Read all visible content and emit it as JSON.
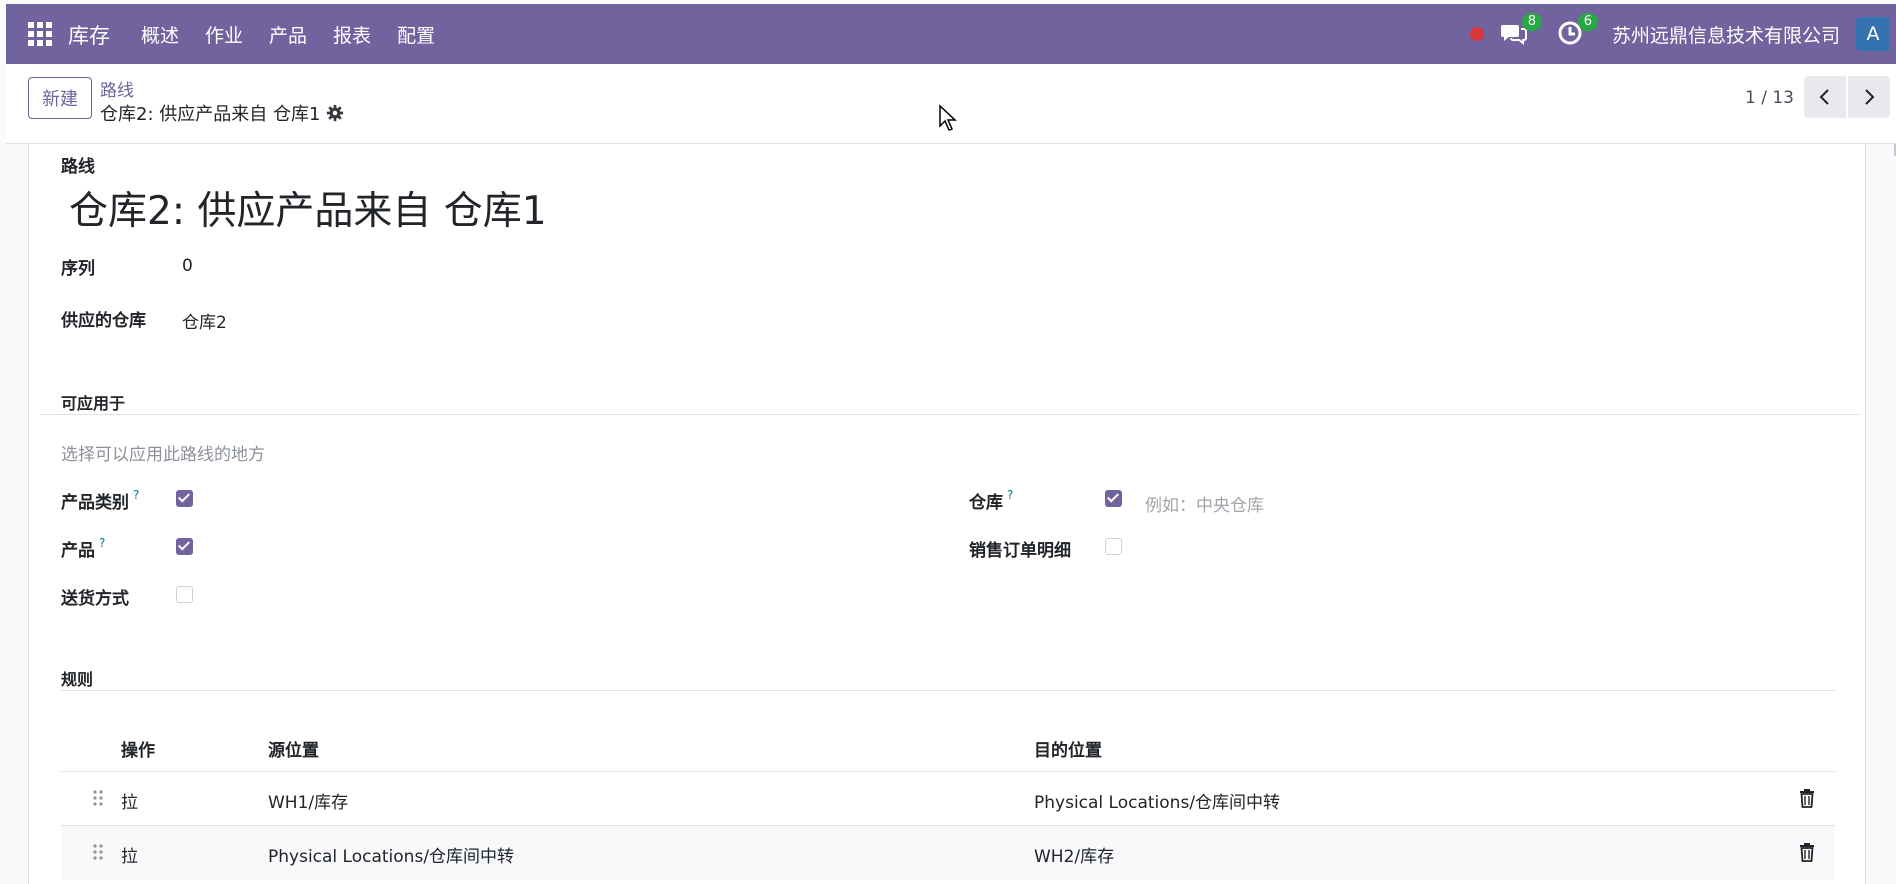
{
  "navbar": {
    "brand": "库存",
    "menu": [
      "概述",
      "作业",
      "产品",
      "报表",
      "配置"
    ],
    "messages_count": "8",
    "activities_count": "6",
    "company": "苏州远鼎信息技术有限公司",
    "avatar": "A",
    "bg_color": "#71639e"
  },
  "control": {
    "new_label": "新建",
    "breadcrumb_parent": "路线",
    "breadcrumb_current": "仓库2: 供应产品来自 仓库1",
    "pager": "1 / 13"
  },
  "form": {
    "route_label": "路线",
    "route_name": "仓库2: 供应产品来自 仓库1",
    "sequence_label": "序列",
    "sequence_value": "0",
    "supplied_wh_label": "供应的仓库",
    "supplied_wh_value": "仓库2",
    "applicable_title": "可应用于",
    "applicable_hint": "选择可以应用此路线的地方",
    "product_category_label": "产品类别",
    "product_label": "产品",
    "shipping_label": "送货方式",
    "warehouse_label": "仓库",
    "warehouse_placeholder": "例如：中央仓库",
    "sale_line_label": "销售订单明细",
    "help_mark": "?",
    "checks": {
      "product_category": true,
      "product": true,
      "shipping": false,
      "warehouse": true,
      "sale_line": false
    }
  },
  "rules": {
    "title": "规则",
    "columns": [
      "操作",
      "源位置",
      "目的位置"
    ],
    "rows": [
      {
        "action": "拉",
        "source": "WH1/库存",
        "dest": "Physical Locations/仓库间中转"
      },
      {
        "action": "拉",
        "source": "Physical Locations/仓库间中转",
        "dest": "WH2/库存"
      }
    ]
  }
}
